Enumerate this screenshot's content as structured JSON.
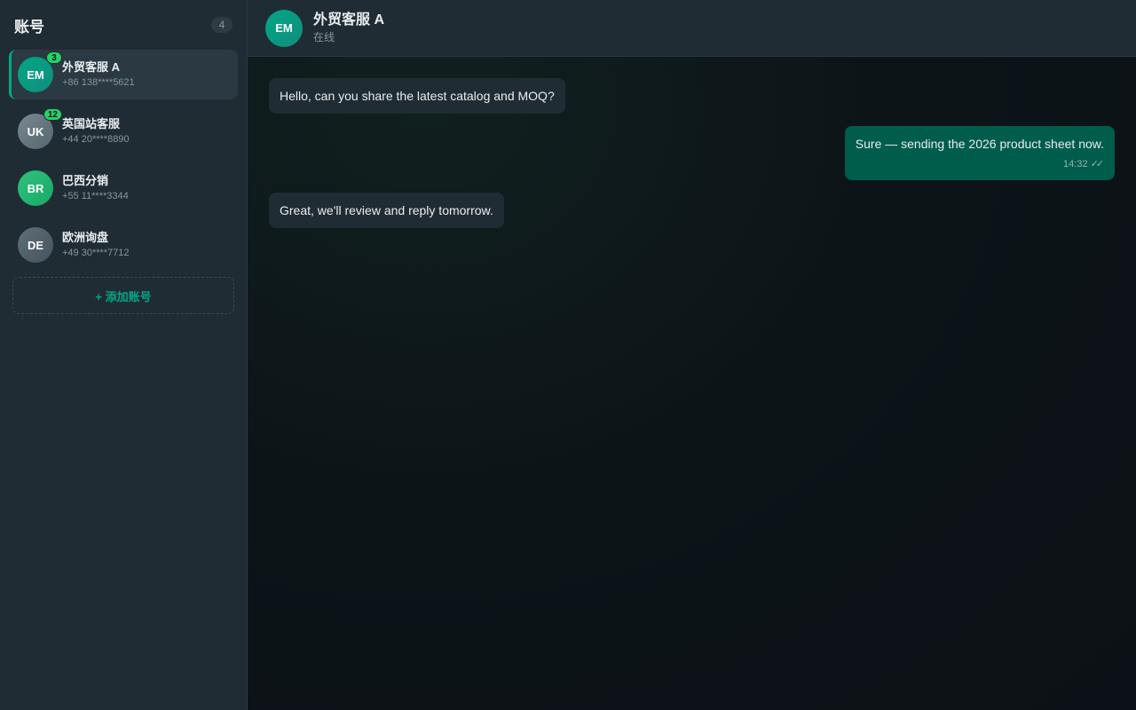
{
  "sidebar": {
    "title": "账号",
    "count": "4",
    "accounts": [
      {
        "initials": "EM",
        "name": "外贸客服 A",
        "phone": "+86 138****5621",
        "unread": "3",
        "avatar_color": "#00a884",
        "active": true
      },
      {
        "initials": "UK",
        "name": "英国站客服",
        "phone": "+44 20****8890",
        "unread": "12",
        "avatar_color": "#6b7c85",
        "active": false
      },
      {
        "initials": "BR",
        "name": "巴西分销",
        "phone": "+55 11****3344",
        "unread": "",
        "avatar_color": "#25b874",
        "active": false
      },
      {
        "initials": "DE",
        "name": "欧洲询盘",
        "phone": "+49 30****7712",
        "unread": "",
        "avatar_color": "#54656f",
        "active": false
      }
    ],
    "add_label": "+ 添加账号"
  },
  "chat": {
    "header": {
      "initials": "EM",
      "name": "外贸客服 A",
      "status": "在线"
    },
    "messages": [
      {
        "direction": "in",
        "text": "Hello, can you share the latest catalog and MOQ?"
      },
      {
        "direction": "out",
        "text": "Sure — sending the 2026 product sheet now.",
        "time": "14:32",
        "ticks": "✓✓"
      },
      {
        "direction": "in",
        "text": "Great, we'll review and reply tomorrow."
      }
    ]
  },
  "colors": {
    "accent": "#00a884",
    "unread_badge": "#25d366",
    "outgoing_bubble": "#005c4b",
    "incoming_bubble": "#202c33"
  }
}
